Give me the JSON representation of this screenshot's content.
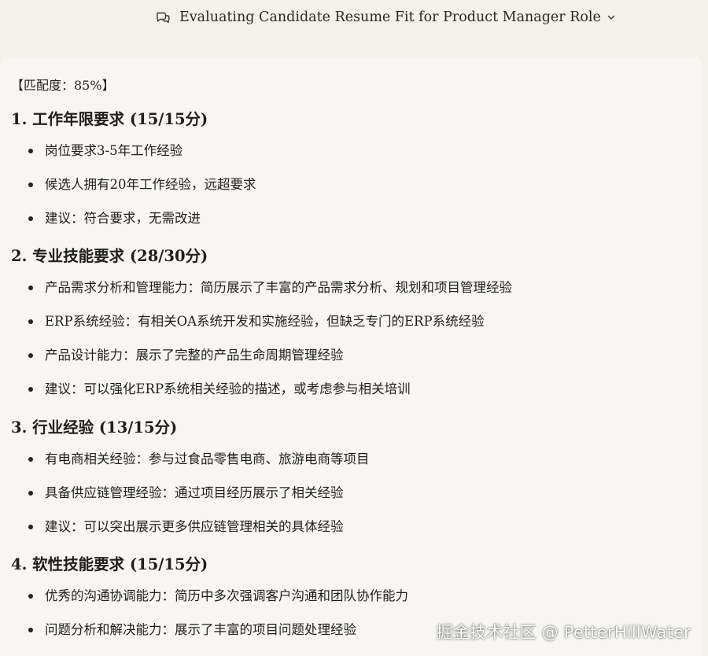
{
  "header": {
    "title": "Evaluating Candidate Resume Fit for Product Manager Role",
    "icons": {
      "chat": "chat-bubbles-icon",
      "dropdown": "chevron-down-icon"
    }
  },
  "content": {
    "match_score": "【匹配度：85%】",
    "sections": [
      {
        "title": "1. 工作年限要求 (15/15分)",
        "items": [
          "岗位要求3-5年工作经验",
          "候选人拥有20年工作经验，远超要求",
          "建议：符合要求，无需改进"
        ]
      },
      {
        "title": "2. 专业技能要求 (28/30分)",
        "items": [
          "产品需求分析和管理能力：简历展示了丰富的产品需求分析、规划和项目管理经验",
          "ERP系统经验：有相关OA系统开发和实施经验，但缺乏专门的ERP系统经验",
          "产品设计能力：展示了完整的产品生命周期管理经验",
          "建议：可以强化ERP系统相关经验的描述，或考虑参与相关培训"
        ]
      },
      {
        "title": "3. 行业经验 (13/15分)",
        "items": [
          "有电商相关经验：参与过食品零售电商、旅游电商等项目",
          "具备供应链管理经验：通过项目经历展示了相关经验",
          "建议：可以突出展示更多供应链管理相关的具体经验"
        ]
      },
      {
        "title": "4. 软性技能要求 (15/15分)",
        "items": [
          "优秀的沟通协调能力：简历中多次强调客户沟通和团队协作能力",
          "问题分析和解决能力：展示了丰富的项目问题处理经验"
        ]
      }
    ]
  },
  "watermark": "掘金技术社区 @ PetterHillWater",
  "colors": {
    "background": "#f3f1ea",
    "panel": "#f7f6f2",
    "text": "#1f1e1b"
  }
}
